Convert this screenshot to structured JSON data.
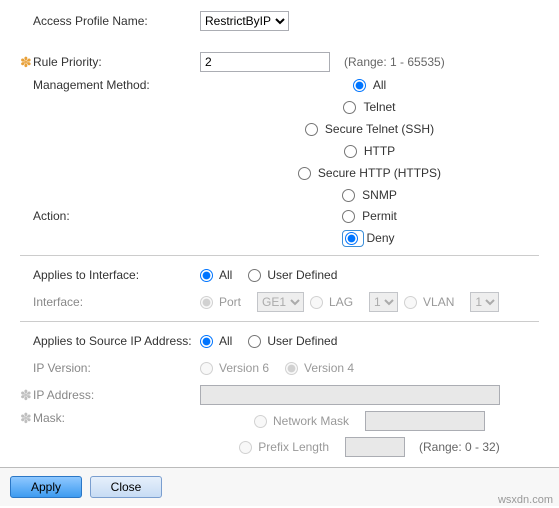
{
  "profile": {
    "label": "Access Profile Name:",
    "value": "RestrictByIP"
  },
  "priority": {
    "label": "Rule Priority:",
    "value": "2",
    "hint": "(Range: 1 - 65535)"
  },
  "mgmt": {
    "label": "Management Method:",
    "options": [
      "All",
      "Telnet",
      "Secure Telnet (SSH)",
      "HTTP",
      "Secure HTTP (HTTPS)",
      "SNMP"
    ]
  },
  "action": {
    "label": "Action:",
    "options": [
      "Permit",
      "Deny"
    ]
  },
  "applyIf": {
    "label": "Applies to Interface:",
    "all": "All",
    "user": "User Defined",
    "iface_label": "Interface:",
    "port": "Port",
    "port_val": "GE1",
    "lag": "LAG",
    "lag_val": "1",
    "vlan": "VLAN",
    "vlan_val": "1"
  },
  "applyIp": {
    "label": "Applies to Source IP Address:",
    "all": "All",
    "user": "User Defined",
    "ipver_label": "IP Version:",
    "v6": "Version 6",
    "v4": "Version 4",
    "ipaddr_label": "IP Address:",
    "mask_label": "Mask:",
    "nm": "Network Mask",
    "pl": "Prefix Length",
    "pl_hint": "(Range: 0 - 32)"
  },
  "footer": {
    "apply": "Apply",
    "close": "Close"
  },
  "watermark": "wsxdn.com"
}
